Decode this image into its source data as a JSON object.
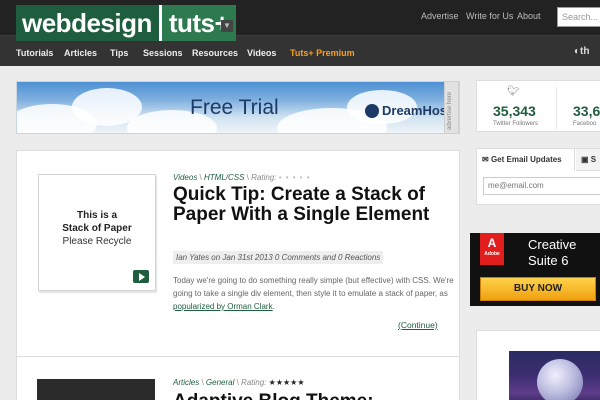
{
  "header": {
    "logo_left": "webdesign",
    "logo_right": "tuts+",
    "links": [
      "Advertise",
      "Write for Us",
      "About"
    ],
    "search_placeholder": "Search..."
  },
  "nav": {
    "items": [
      "Tutorials",
      "Articles",
      "Tips",
      "Sessions",
      "Resources",
      "Videos",
      "Tuts+ Premium"
    ],
    "right_text": "th"
  },
  "banner": {
    "title": "Free Trial",
    "brand": "DreamHost",
    "side_label": "advertise here"
  },
  "articles": [
    {
      "categories": [
        "Videos",
        "HTML/CSS"
      ],
      "rating_label": "Rating:",
      "rating_display": "• • • • •",
      "thumb_lines": [
        "This is a",
        "Stack of Paper",
        "Please Recycle"
      ],
      "title": "Quick Tip: Create a Stack of Paper With a Single Element",
      "meta": "Ian Yates on Jan 31st 2013 0 Comments and 0 Reactions",
      "excerpt_before_link": "Today we're going to do something really simple (but effective) with CSS. We're going to take a single div element, then style it to emulate a stack of paper, as ",
      "excerpt_link": "popularized by Orman Clark",
      "excerpt_after_link": ".",
      "continue_label": "(Continue)"
    },
    {
      "categories": [
        "Articles",
        "General"
      ],
      "rating_label": "Rating:",
      "rating_display": "★★★★★",
      "title": "Adaptive Blog Theme:"
    }
  ],
  "sidebar": {
    "social": {
      "twitter_count": "35,343",
      "twitter_label": "Twitter Followers",
      "facebook_count": "33,6",
      "facebook_label": "Faceboo"
    },
    "updates": {
      "tab_label": "Get Email Updates",
      "tab2_label": "S",
      "email_placeholder": "me@email.com"
    },
    "ad": {
      "brand": "Adobe",
      "line1": "Creative",
      "line2": "Suite 6",
      "button": "BUY NOW"
    }
  },
  "colors": {
    "brand_green": "#1e5e3e",
    "premium_orange": "#f9a21b",
    "header_bg": "#222222"
  }
}
